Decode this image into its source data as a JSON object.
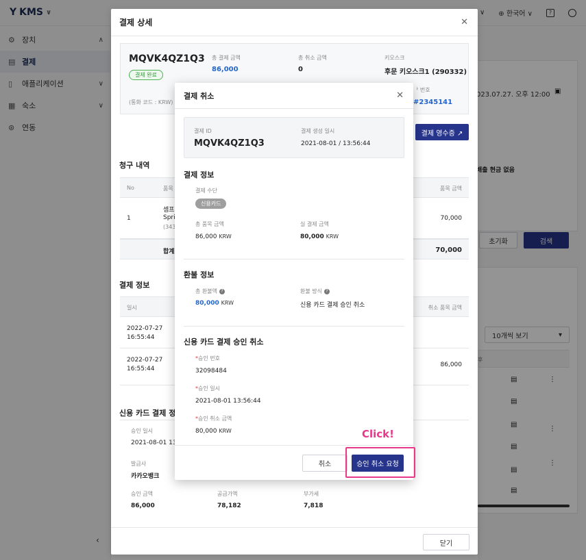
{
  "app": {
    "logo": "KMS",
    "language": "한국어"
  },
  "sidebar": {
    "items": [
      {
        "label": "장치",
        "icon": "gear-icon"
      },
      {
        "label": "결제",
        "icon": "receipt-icon"
      },
      {
        "label": "애플리케이션",
        "icon": "tablet-icon"
      },
      {
        "label": "숙소",
        "icon": "building-icon"
      },
      {
        "label": "연동",
        "icon": "link-icon"
      }
    ]
  },
  "right_bg": {
    "date": "023.07.27. 오후 12:00",
    "no_cash": "배출 현금 없음",
    "reset": "초기화",
    "search": "검색",
    "per_page": "10개씩 보기",
    "col": "후"
  },
  "detail_modal": {
    "title": "결제 상세",
    "summary": {
      "payment_id": "MQVK4QZ1Q3",
      "status_badge": "결제 완료",
      "currency_note": "(통화 코드 : KRW)",
      "total_label": "총 결제 금액",
      "total_value": "86,000",
      "cancel_label": "총 취소 금액",
      "cancel_value": "0",
      "kiosk_label": "키오스크",
      "kiosk_value": "후문 키오스크1 (290332)",
      "order_label": "주문 번호",
      "order_label_visible": "ᅡ 번호",
      "order_value": "#2345141"
    },
    "receipt_button": "결제 영수증 ↗",
    "billing": {
      "title": "청구 내역",
      "col_no": "No",
      "col_item": "품목",
      "col_amount": "품목 금액",
      "row_no": "1",
      "row_item_1": "셈프",
      "row_item_2": "Spri",
      "row_item_3": "(343",
      "row_amount": "70,000",
      "total_label": "합계",
      "total_value": "70,000"
    },
    "payment_info": {
      "title": "결제 정보",
      "col_datetime": "일시",
      "col_cancel_amount": "취소 품목 금액",
      "rows": [
        {
          "date": "2022-07-27",
          "time": "16:55:44",
          "amount": ""
        },
        {
          "date": "2022-07-27",
          "time": "16:55:44",
          "amount": "86,000"
        }
      ]
    },
    "card_info": {
      "title": "신용 카드 결제 정보",
      "approval_datetime_label": "승인 일시",
      "approval_datetime_value": "2021-08-01 13:5",
      "issuer_label": "발급사",
      "issuer_value": "카카오뱅크",
      "approved_amount_label": "승인 금액",
      "approved_amount_value": "86,000",
      "supply_label": "공급가액",
      "supply_value": "78,182",
      "vat_label": "부가세",
      "vat_value": "7,818"
    },
    "close_button": "닫기"
  },
  "cancel_dialog": {
    "title": "결제 취소",
    "payment_id_label": "결제 ID",
    "payment_id_value": "MQVK4QZ1Q3",
    "created_label": "결제 생성 일시",
    "created_value": "2021-08-01 / 13:56:44",
    "payment_info_title": "결제 정보",
    "method_label": "결제 수단",
    "method_value": "신용카드",
    "total_item_label": "총 품목 금액",
    "total_item_value": "86,000",
    "actual_label": "실 결제 금액",
    "actual_value": "80,000",
    "currency": "KRW",
    "refund_title": "환불 정보",
    "total_refund_label": "총 환불액",
    "total_refund_value": "80,000",
    "refund_method_label": "환불 방식",
    "refund_method_value": "신용 카드 결제 승인 취소",
    "card_cancel_title": "신용 카드 결제 승인 취소",
    "approval_no_label": "승인 번호",
    "approval_no_value": "32098484",
    "approval_datetime_label": "승인 일시",
    "approval_datetime_value": "2021-08-01 13:56:44",
    "approval_cancel_amount_label": "승인 취소 금액",
    "approval_cancel_amount_value": "80,000",
    "cancel_button": "취소",
    "confirm_button": "승인 취소 요청"
  },
  "annotation": {
    "click_label": "Click!",
    "color": "#e8388a"
  }
}
